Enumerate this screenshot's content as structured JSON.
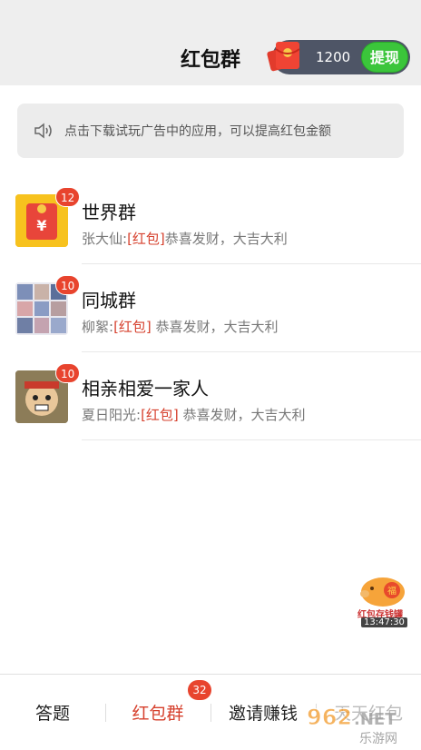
{
  "header": {
    "title": "红包群"
  },
  "balance": {
    "amount": "1200",
    "withdraw_label": "提现"
  },
  "notice": {
    "text": "点击下载试玩广告中的应用，可以提高红包金额"
  },
  "groups": [
    {
      "name": "世界群",
      "badge": "12",
      "sender": "张大仙:",
      "tag": "[红包]",
      "message": "恭喜发财，大吉大利"
    },
    {
      "name": "同城群",
      "badge": "10",
      "sender": "柳絮:",
      "tag": "[红包]",
      "message": " 恭喜发财，大吉大利"
    },
    {
      "name": "相亲相爱一家人",
      "badge": "10",
      "sender": "夏日阳光:",
      "tag": "[红包]",
      "message": " 恭喜发财，大吉大利"
    }
  ],
  "floating": {
    "label": "红包存钱罐",
    "time": "13:47:30"
  },
  "tabs": [
    {
      "label": "答题"
    },
    {
      "label": "红包群",
      "badge": "32"
    },
    {
      "label": "邀请赚钱"
    },
    {
      "label": "天天红包"
    }
  ],
  "watermark": {
    "text": "962.NET",
    "subtext": "乐游网"
  },
  "colors": {
    "accent": "#d6402d",
    "badge": "#e8442e",
    "withdraw": "#3bc53b",
    "balance_bg": "#4e5566"
  }
}
